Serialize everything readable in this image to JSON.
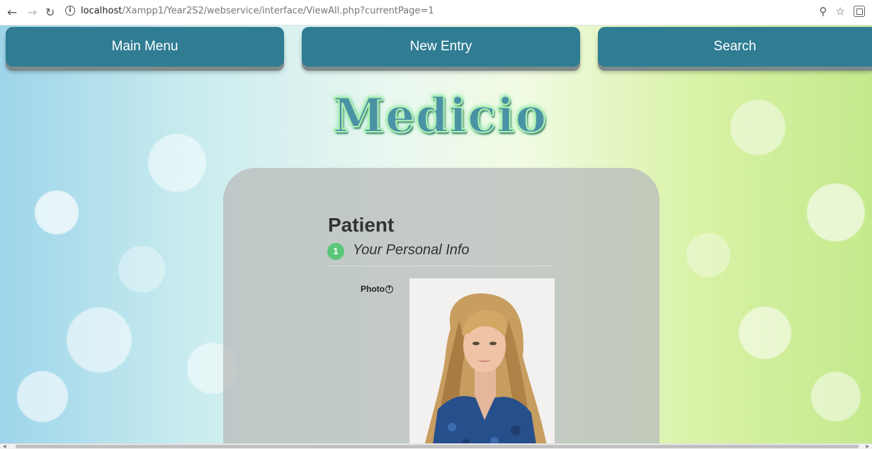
{
  "browser": {
    "url_host": "localhost",
    "url_path": "/Xampp1/Year2S2/webservice/interface/ViewAll.php?currentPage=1"
  },
  "nav": {
    "main_menu": "Main Menu",
    "new_entry": "New Entry",
    "search": "Search"
  },
  "brand": {
    "logo_text": "Medicio"
  },
  "card": {
    "title": "Patient",
    "step_number": "1",
    "step_label": "Your Personal Info",
    "photo_label": "Photo"
  },
  "colors": {
    "nav_button": "#2f7c93",
    "step_badge": "#5bc77a",
    "logo_fill": "#4a93a4"
  },
  "icons": [
    "back-arrow-icon",
    "forward-arrow-icon",
    "reload-icon",
    "info-icon",
    "zoom-icon",
    "star-icon",
    "extension-icon",
    "upload-icon"
  ]
}
